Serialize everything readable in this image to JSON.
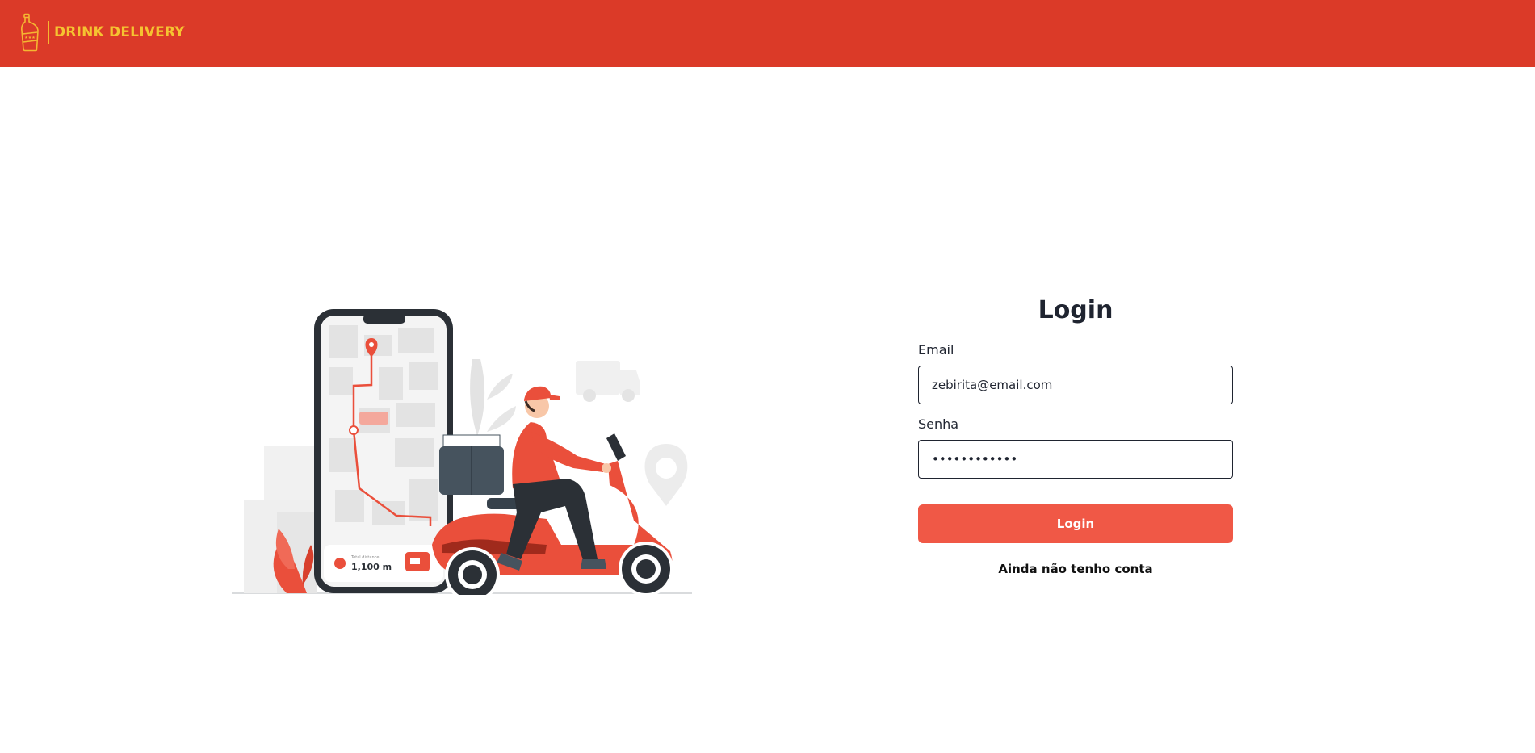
{
  "header": {
    "brand_name": "DRINK DELIVERY",
    "background_color": "#db3a28",
    "brand_color": "#f5c331",
    "logo_icon": "bottle-icon"
  },
  "illustration": {
    "subject": "delivery-scooter-phone-map",
    "distance_label": "Total distance",
    "distance_value": "1,100 m"
  },
  "login": {
    "title": "Login",
    "email_label": "Email",
    "email_value": "zebirita@email.com",
    "password_label": "Senha",
    "password_value": "••••••••••••",
    "submit_label": "Login",
    "register_link": "Ainda não tenho conta",
    "button_color": "#f05846"
  }
}
